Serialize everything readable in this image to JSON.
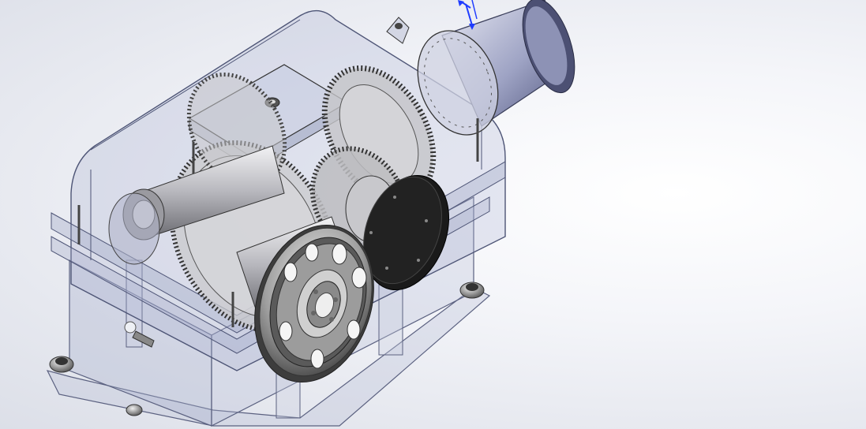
{
  "viewport": {
    "background_center": "#ffffff",
    "background_edge": "#dcdfe8"
  },
  "model": {
    "housing_color": "#9aa3c4",
    "gear_color": "#bfbfbf",
    "shaft_color": "#d8d8dc",
    "motor_color": "#7b82a8",
    "pulley_color": "#8c8c8c",
    "flange_color": "#1a1a1a",
    "triad_color": "#1f3cff"
  },
  "triad": {
    "icon": "reference-triad-icon"
  }
}
